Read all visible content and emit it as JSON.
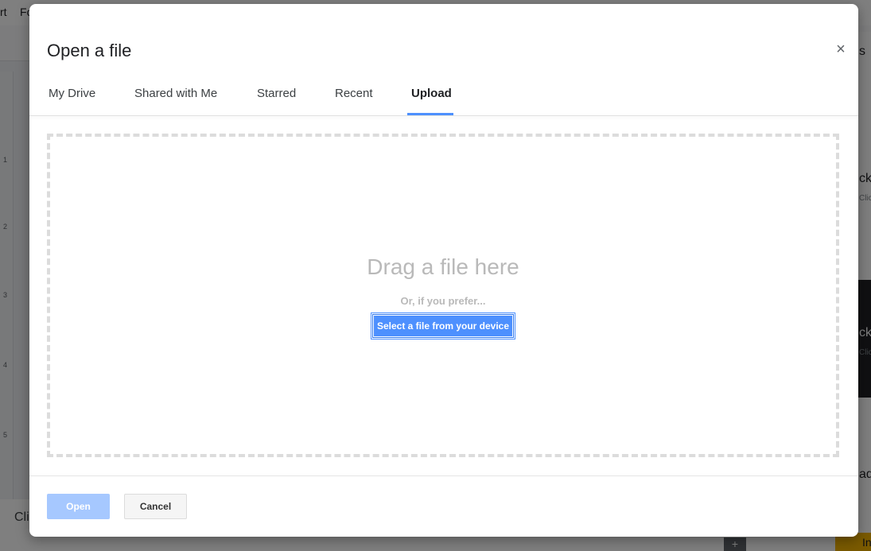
{
  "background": {
    "menu_items": [
      "rt",
      "Fo"
    ],
    "ruler_marks": [
      "1",
      "2",
      "3",
      "4",
      "5"
    ],
    "bottom_text": "Cli",
    "side_texts": [
      "s",
      "ck",
      "Clic",
      "ck",
      "Clic",
      "ade"
    ],
    "yellow_button": "In"
  },
  "dialog": {
    "title": "Open a file",
    "close_glyph": "×",
    "tabs": [
      {
        "label": "My Drive"
      },
      {
        "label": "Shared with Me"
      },
      {
        "label": "Starred"
      },
      {
        "label": "Recent"
      },
      {
        "label": "Upload",
        "active": true
      }
    ],
    "upload": {
      "drag_text": "Drag a file here",
      "prefer_text": "Or, if you prefer...",
      "select_button": "Select a file from your device"
    },
    "footer": {
      "open_label": "Open",
      "cancel_label": "Cancel"
    }
  },
  "colors": {
    "accent": "#4d90fe",
    "open_disabled": "#a6c8ff"
  }
}
